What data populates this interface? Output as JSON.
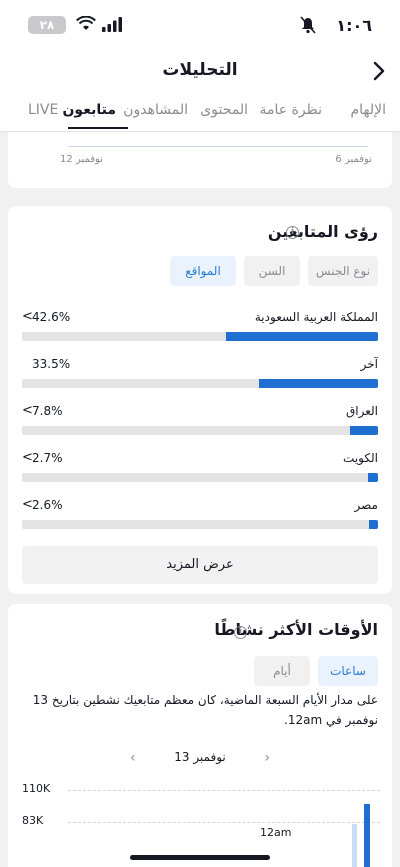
{
  "status": {
    "time": "١:٠٦",
    "battery": "٢٨"
  },
  "header": {
    "title": "التحليلات",
    "back_icon": "chevron-right-icon"
  },
  "tabs": [
    {
      "label": "الإلهام",
      "active": false
    },
    {
      "label": "نظرة عامة",
      "active": false
    },
    {
      "label": "المحتوى",
      "active": false
    },
    {
      "label": "المشاهدون",
      "active": false
    },
    {
      "label": "متابعون",
      "active": true
    },
    {
      "label": "LIVE",
      "active": false
    }
  ],
  "chart_top": {
    "x_labels": [
      "نوفمبر 6",
      "نوفمبر 12"
    ]
  },
  "follower_insights": {
    "title": "رؤى المتابعين",
    "filters": [
      {
        "label": "نوع الجنس",
        "active": false
      },
      {
        "label": "السن",
        "active": false
      },
      {
        "label": "المواقع",
        "active": true
      }
    ],
    "locations": [
      {
        "name": "المملكة العربية السعودية",
        "pct_text": "42.6%",
        "value": 42.6,
        "chevron": "<"
      },
      {
        "name": "آخر",
        "pct_text": "33.5%",
        "value": 33.5,
        "chevron": ""
      },
      {
        "name": "العراق",
        "pct_text": "7.8%",
        "value": 7.8,
        "chevron": "<"
      },
      {
        "name": "الكويت",
        "pct_text": "2.7%",
        "value": 2.7,
        "chevron": "<"
      },
      {
        "name": "مصر",
        "pct_text": "2.6%",
        "value": 2.6,
        "chevron": "<"
      }
    ],
    "show_more": "عرض المزيد"
  },
  "active_times": {
    "title": "الأوقات الأكثر نشاطًا",
    "toggle": [
      {
        "label": "ساعات",
        "active": true
      },
      {
        "label": "أيام",
        "active": false
      }
    ],
    "description": "على مدار الأيام السبعة الماضية، كان معظم متابعيك نشطين بتاريخ 13 نوفمبر في 12am.",
    "date": "13 نوفمبر",
    "y_labels": [
      "110K",
      "83K"
    ],
    "hour_label": "12am"
  },
  "colors": {
    "accent": "#1f6fd1",
    "track": "#e3e3e4"
  }
}
